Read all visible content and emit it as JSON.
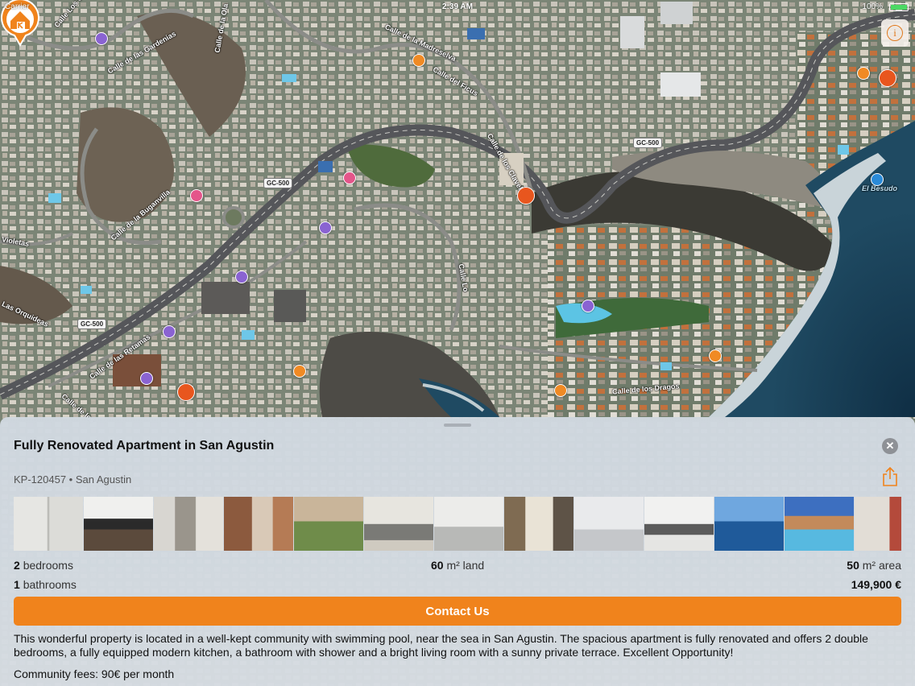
{
  "status_bar": {
    "carrier": "Carrier",
    "time": "2:39 AM",
    "battery": "100%"
  },
  "map": {
    "roads": [
      "Calle Los Cl",
      "Calle de las Gardenias",
      "Calle de la Ola",
      "Calle de la Madreselva",
      "Calle del Ficus",
      "Calle de los Claveles",
      "Calle de la Buganvilla",
      "Violetas",
      "Las Orquideas",
      "Calle de las Retamas",
      "Calle de los",
      "Calle Lo",
      "Calle de los Dragos",
      "El Besudo"
    ],
    "shields": [
      "GC-500",
      "GC-500",
      "GC-500"
    ]
  },
  "listing": {
    "title": "Fully Renovated Apartment in San Agustin",
    "ref": "KP-120457 • San Agustin",
    "bedrooms_num": "2",
    "bedrooms_label": "bedrooms",
    "bathrooms_num": "1",
    "bathrooms_label": "bathrooms",
    "land_num": "60",
    "land_label": "m² land",
    "area_num": "50",
    "area_label": "m² area",
    "price": "149,900 €",
    "contact_label": "Contact Us",
    "description": "This wonderful property is located in a well-kept community with swimming pool, near the sea in San Agustin. The spacious apartment is fully renovated and offers 2 double bedrooms, a fully equipped modern kitchen, a bathroom with shower and a bright living room with a sunny private terrace. Excellent Opportunity!",
    "fees": "Community fees: 90€ per month"
  },
  "colors": {
    "accent": "#f0831c",
    "sheet": "#d3d9df"
  }
}
